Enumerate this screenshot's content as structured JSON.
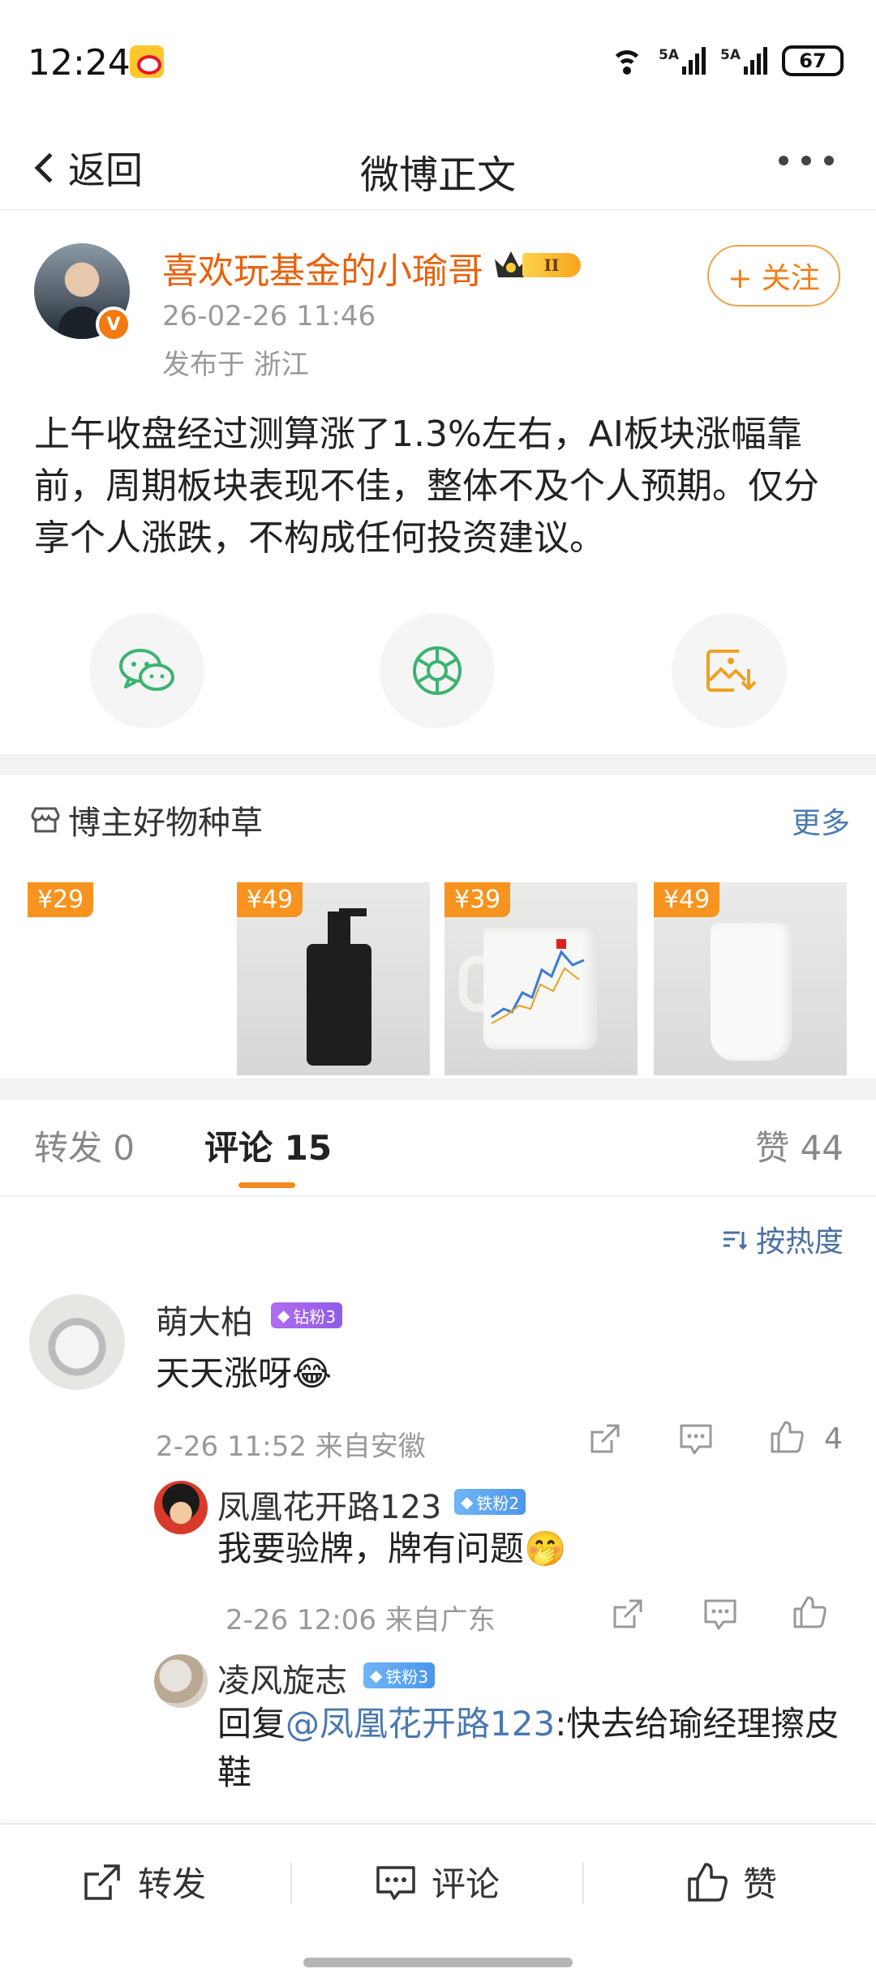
{
  "status_bar": {
    "time": "12:24",
    "signal1": "5A",
    "signal2": "5A",
    "battery": "67"
  },
  "nav": {
    "back_label": "返回",
    "title": "微博正文"
  },
  "post": {
    "author": "喜欢玩基金的小瑜哥",
    "member_level": "II",
    "time": "26-02-26 11:46",
    "location": "发布于 浙江",
    "follow_label": "+ 关注",
    "text": "上午收盘经过测算涨了1.3%左右，AI板块涨幅靠前，周期板块表现不佳，整体不及个人预期。仅分享个人涨跌，不构成任何投资建议。"
  },
  "share": [
    "wechat-icon",
    "moments-icon",
    "save-image-icon"
  ],
  "goods": {
    "title": "博主好物种草",
    "more_label": "更多",
    "items": [
      {
        "price": "¥29"
      },
      {
        "price": "¥49"
      },
      {
        "price": "¥39"
      },
      {
        "price": "¥49"
      }
    ]
  },
  "tabs": {
    "repost": "转发 0",
    "comment": "评论 15",
    "like": "赞 44"
  },
  "sort_label": "按热度",
  "comments": [
    {
      "name": "萌大柏",
      "badge": "钻粉3",
      "text": "天天涨呀",
      "emoji": "😂",
      "meta": "2-26 11:52 来自安徽",
      "likes": "4"
    },
    {
      "name": "凤凰花开路123",
      "badge": "铁粉2",
      "text": "我要验牌，牌有问题",
      "emoji": "🤭",
      "meta": "2-26 12:06 来自广东"
    },
    {
      "name": "凌风旋志",
      "badge": "铁粉3",
      "reply_prefix": "回复",
      "mention": "@凤凰花开路123",
      "text": ":快去给瑜经理擦皮鞋"
    }
  ],
  "bottom_bar": {
    "repost": "转发",
    "comment": "评论",
    "like": "赞"
  },
  "colors": {
    "accent": "#f58a1f",
    "link": "#4a78b0",
    "name_orange": "#e8620f"
  }
}
